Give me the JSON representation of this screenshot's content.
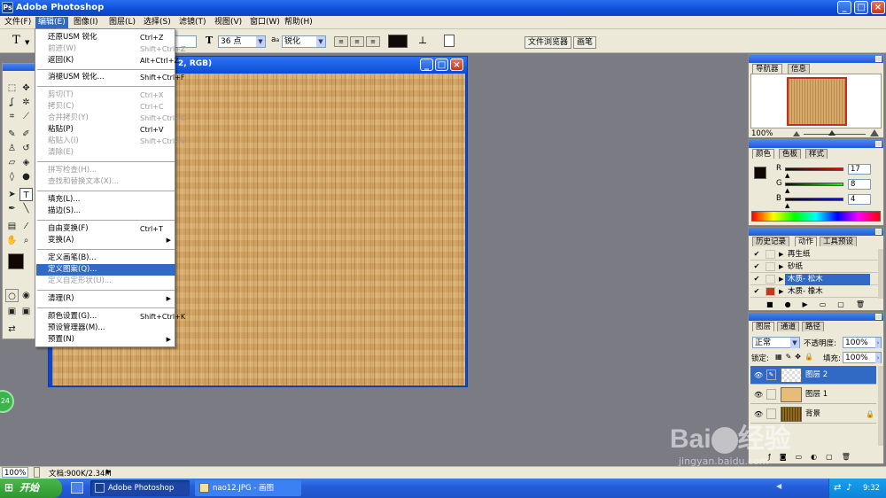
{
  "app": {
    "title": "Adobe Photoshop"
  },
  "menubar": {
    "items": [
      "文件(F)",
      "编辑(E)",
      "图像(I)",
      "图层(L)",
      "选择(S)",
      "滤镜(T)",
      "视图(V)",
      "窗口(W)",
      "帮助(H)"
    ]
  },
  "options": {
    "tool_glyph": "T",
    "font_size": "36 点",
    "aa_label": "a",
    "aa_mode": "锐化",
    "tab_file_browser": "文件浏览器",
    "tab_brushes": "画笔",
    "text_color": "#0f0a08"
  },
  "document": {
    "title_fragment": "2, RGB)",
    "zoom": "100%",
    "doc_size": "文档:900K/2.34M",
    "wood_color": "#d6a968"
  },
  "edit_menu": {
    "items": [
      {
        "label": "还原USM 锐化",
        "shortcut": "Ctrl+Z",
        "disabled": false
      },
      {
        "label": "前进(W)",
        "shortcut": "Shift+Ctrl+Z",
        "disabled": true
      },
      {
        "label": "返回(K)",
        "shortcut": "Alt+Ctrl+Z",
        "disabled": false
      },
      {
        "label": "消褪USM 锐化...",
        "shortcut": "Shift+Ctrl+F",
        "disabled": false
      },
      {
        "label": "剪切(T)",
        "shortcut": "Ctrl+X",
        "disabled": true
      },
      {
        "label": "拷贝(C)",
        "shortcut": "Ctrl+C",
        "disabled": true
      },
      {
        "label": "合并拷贝(Y)",
        "shortcut": "Shift+Ctrl+C",
        "disabled": true
      },
      {
        "label": "粘贴(P)",
        "shortcut": "Ctrl+V",
        "disabled": false
      },
      {
        "label": "粘贴入(I)",
        "shortcut": "Shift+Ctrl+V",
        "disabled": true
      },
      {
        "label": "清除(E)",
        "shortcut": "",
        "disabled": true
      },
      {
        "label": "拼写检查(H)...",
        "shortcut": "",
        "disabled": true
      },
      {
        "label": "查找和替换文本(X)...",
        "shortcut": "",
        "disabled": true
      },
      {
        "label": "填充(L)...",
        "shortcut": "",
        "disabled": false
      },
      {
        "label": "描边(S)...",
        "shortcut": "",
        "disabled": false
      },
      {
        "label": "自由变换(F)",
        "shortcut": "Ctrl+T",
        "disabled": false
      },
      {
        "label": "变换(A)",
        "shortcut": "",
        "disabled": false,
        "submenu": true
      },
      {
        "label": "定义画笔(B)...",
        "shortcut": "",
        "disabled": false
      },
      {
        "label": "定义图案(Q)...",
        "shortcut": "",
        "disabled": false,
        "highlighted": true
      },
      {
        "label": "定义自定形状(U)...",
        "shortcut": "",
        "disabled": true
      },
      {
        "label": "清理(R)",
        "shortcut": "",
        "disabled": false,
        "submenu": true
      },
      {
        "label": "颜色设置(G)...",
        "shortcut": "Shift+Ctrl+K",
        "disabled": false
      },
      {
        "label": "预设管理器(M)...",
        "shortcut": "",
        "disabled": false
      },
      {
        "label": "预置(N)",
        "shortcut": "",
        "disabled": false,
        "submenu": true
      }
    ]
  },
  "navigator": {
    "tabs": [
      "导航器",
      "信息"
    ],
    "zoom": "100%"
  },
  "color": {
    "tabs": [
      "颜色",
      "色板",
      "样式"
    ],
    "r_label": "R",
    "g_label": "G",
    "b_label": "B",
    "r": "17",
    "g": "8",
    "b": "4",
    "foreground": "#110804"
  },
  "actions": {
    "tabs": [
      "历史记录",
      "动作",
      "工具预设"
    ],
    "items": [
      {
        "name": "再生纸",
        "selected": false
      },
      {
        "name": "砂纸",
        "selected": false
      },
      {
        "name": "木质- 松木",
        "selected": true
      },
      {
        "name": "木质- 橡木",
        "selected": false
      }
    ]
  },
  "layers": {
    "tabs": [
      "图层",
      "通道",
      "路径"
    ],
    "blend_mode": "正常",
    "opacity_label": "不透明度:",
    "opacity": "100%",
    "lock_label": "锁定:",
    "fill_label": "填充:",
    "fill": "100%",
    "items": [
      {
        "name": "图层 2",
        "selected": true,
        "thumb": "checker"
      },
      {
        "name": "图层 1",
        "selected": false,
        "thumb": "#e5bc7a"
      },
      {
        "name": "背景",
        "selected": false,
        "thumb": "#8f6a1a",
        "locked": true
      }
    ]
  },
  "taskbar": {
    "start": "开始",
    "tasks": [
      "Adobe Photoshop",
      "nao12.JPG - 画图"
    ],
    "clock": "9:32"
  },
  "badge": {
    "text": "24"
  },
  "watermark": {
    "site": "jingyan.baidu.com"
  }
}
